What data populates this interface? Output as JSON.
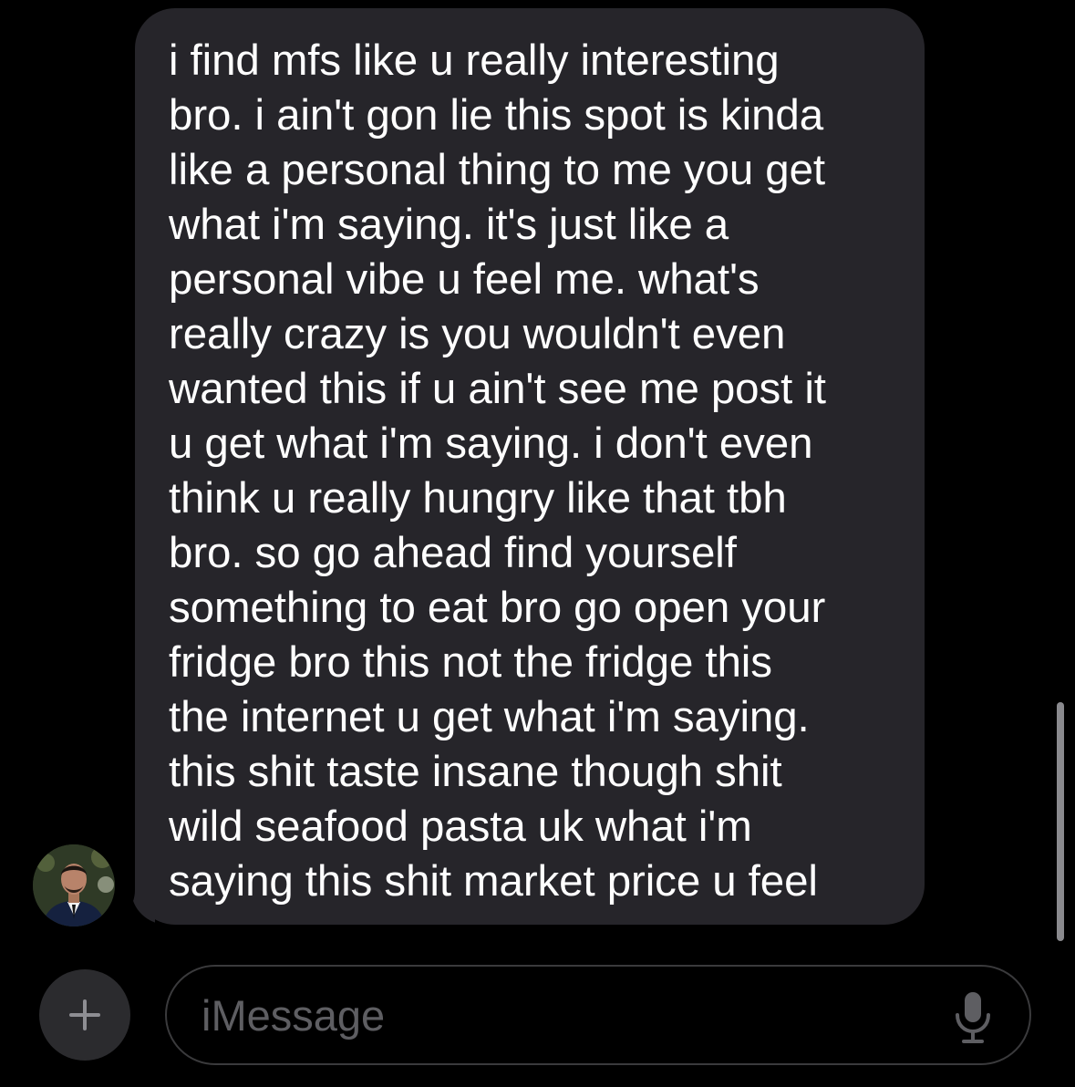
{
  "message": {
    "lines": [
      "i find mfs like u really interesting",
      "bro. i ain't gon lie this spot is kinda",
      "like a personal thing to me you get",
      "what i'm saying. it's just like a",
      "personal vibe u feel me. what's",
      "really crazy is you wouldn't even",
      "wanted this if u ain't see me post it",
      "u get what i'm saying. i don't even",
      "think u really hungry like that tbh",
      "bro. so go ahead find yourself",
      "something to eat bro go open your",
      "fridge bro this not the fridge this",
      "the internet u get what i'm saying.",
      "this shit taste insane though shit",
      "wild seafood pasta uk what i'm",
      "saying this shit market price u feel"
    ],
    "bubble_color": "#26252a",
    "text_color": "#ffffff"
  },
  "sender": {
    "avatar_icon": "profile-photo"
  },
  "composer": {
    "plus_icon": "plus-icon",
    "placeholder": "iMessage",
    "mic_icon": "microphone-icon"
  },
  "colors": {
    "background": "#000000",
    "placeholder": "#5e5e62",
    "field_border": "#3a3a3c"
  }
}
